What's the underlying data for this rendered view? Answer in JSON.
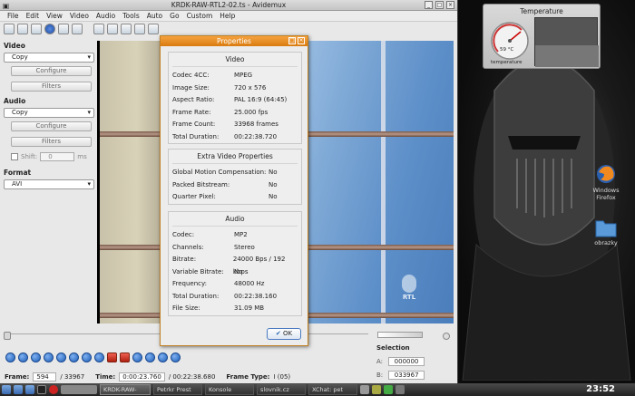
{
  "window": {
    "title": "KRDK-RAW-RTL2-02.ts - Avidemux"
  },
  "menu": [
    "File",
    "Edit",
    "View",
    "Video",
    "Audio",
    "Tools",
    "Auto",
    "Go",
    "Custom",
    "Help"
  ],
  "left_panel": {
    "video_title": "Video",
    "video_codec": "Copy",
    "configure_label": "Configure",
    "filters_label": "Filters",
    "audio_title": "Audio",
    "audio_codec": "Copy",
    "audio_configure_label": "Configure",
    "audio_filters_label": "Filters",
    "shift_label": "Shift:",
    "shift_value": "0",
    "shift_unit": "ms",
    "format_title": "Format",
    "format_value": "AVI"
  },
  "video_overlay": {
    "logo": "RTL"
  },
  "status": {
    "frame_label": "Frame:",
    "frame_value": "594",
    "frame_total": "/ 33967",
    "time_label": "Time:",
    "time_value": "0:00:23.760",
    "time_total": "/ 00:22:38.680",
    "frame_type_label": "Frame Type:",
    "frame_type_value": "I (05)"
  },
  "selection": {
    "title": "Selection",
    "a_label": "A:",
    "a_value": "000000",
    "b_label": "B:",
    "b_value": "033967"
  },
  "dialog": {
    "title": "Properties",
    "ok_label": "OK",
    "video": {
      "title": "Video",
      "rows": [
        {
          "label": "Codec 4CC:",
          "value": "MPEG"
        },
        {
          "label": "Image Size:",
          "value": "720 x 576"
        },
        {
          "label": "Aspect Ratio:",
          "value": "PAL 16:9 (64:45)"
        },
        {
          "label": "Frame Rate:",
          "value": "25.000 fps"
        },
        {
          "label": "Frame Count:",
          "value": "33968 frames"
        },
        {
          "label": "Total Duration:",
          "value": "00:22:38.720"
        }
      ]
    },
    "extra": {
      "title": "Extra Video Properties",
      "rows": [
        {
          "label": "Global Motion Compensation:",
          "value": "No"
        },
        {
          "label": "Packed Bitstream:",
          "value": "No"
        },
        {
          "label": "Quarter Pixel:",
          "value": "No"
        }
      ]
    },
    "audio": {
      "title": "Audio",
      "rows": [
        {
          "label": "Codec:",
          "value": "MP2"
        },
        {
          "label": "Channels:",
          "value": "Stereo"
        },
        {
          "label": "Bitrate:",
          "value": "24000 Bps / 192 kbps"
        },
        {
          "label": "Variable Bitrate:",
          "value": "No"
        },
        {
          "label": "Frequency:",
          "value": "48000 Hz"
        },
        {
          "label": "Total Duration:",
          "value": "00:22:38.160"
        },
        {
          "label": "File Size:",
          "value": "31.09 MB"
        }
      ]
    }
  },
  "temperature_widget": {
    "title": "Temperature",
    "value": "59 °C",
    "label": "temperature"
  },
  "desktop_icons": [
    {
      "label_line1": "Windows",
      "label_line2": "Firefox"
    },
    {
      "label_line1": "obrazky",
      "label_line2": ""
    }
  ],
  "taskbar": {
    "tasks": [
      "KRDK-RAW-",
      "Petrkr Prest",
      "Konsole",
      "slovnik.cz",
      "XChat: pet"
    ],
    "clock": "23:52"
  },
  "colors": {
    "dialog_title": "#e88a20",
    "control_button": "#1f5fb8"
  }
}
